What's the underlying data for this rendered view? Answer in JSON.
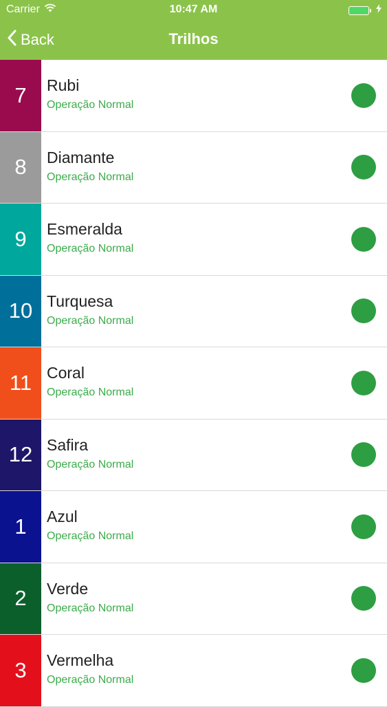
{
  "status_bar": {
    "carrier": "Carrier",
    "time": "10:47 AM",
    "battery_color": "#4cd964"
  },
  "nav": {
    "back_label": "Back",
    "title": "Trilhos",
    "bar_color": "#8bc34a"
  },
  "status_color": "#3bab4a",
  "indicator_color": "#2e9e43",
  "lines": [
    {
      "number": "7",
      "name": "Rubi",
      "status": "Operação Normal",
      "color": "#9a0b4e"
    },
    {
      "number": "8",
      "name": "Diamante",
      "status": "Operação Normal",
      "color": "#9b9b9b"
    },
    {
      "number": "9",
      "name": "Esmeralda",
      "status": "Operação Normal",
      "color": "#00a79c"
    },
    {
      "number": "10",
      "name": "Turquesa",
      "status": "Operação Normal",
      "color": "#006f9a"
    },
    {
      "number": "11",
      "name": "Coral",
      "status": "Operação Normal",
      "color": "#f04e1b"
    },
    {
      "number": "12",
      "name": "Safira",
      "status": "Operação Normal",
      "color": "#1e1668"
    },
    {
      "number": "1",
      "name": "Azul",
      "status": "Operação Normal",
      "color": "#0a1290"
    },
    {
      "number": "2",
      "name": "Verde",
      "status": "Operação Normal",
      "color": "#0b5f2b"
    },
    {
      "number": "3",
      "name": "Vermelha",
      "status": "Operação Normal",
      "color": "#e3101b"
    }
  ]
}
